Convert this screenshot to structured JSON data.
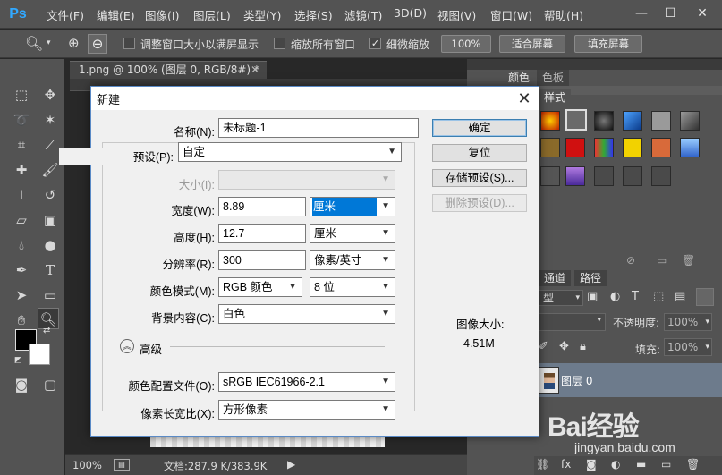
{
  "app": {
    "logo": "Ps"
  },
  "menubar": {
    "items": [
      "文件(F)",
      "编辑(E)",
      "图像(I)",
      "图层(L)",
      "类型(Y)",
      "选择(S)",
      "滤镜(T)",
      "3D(D)",
      "视图(V)",
      "窗口(W)",
      "帮助(H)"
    ],
    "window_controls": {
      "minimize": "—",
      "maximize": "☐",
      "close": "✕"
    }
  },
  "options": {
    "resize_windows": "调整窗口大小以满屏显示",
    "zoom_all": "缩放所有窗口",
    "scrubby": "细微缩放",
    "zoom_pct": "100%",
    "fit_screen": "适合屏幕",
    "fill_screen": "填充屏幕"
  },
  "document": {
    "tab": "1.png @ 100% (图层 0, RGB/8#) *",
    "zoom": "100%",
    "doc_info": "文档:287.9 K/383.9K"
  },
  "panels": {
    "color_tab": "颜色",
    "swatches_tab": "色板",
    "styles_tab": "样式",
    "channels_tab": "通道",
    "paths_tab": "路径",
    "kind": "型",
    "opacity_label": "不透明度:",
    "opacity": "100%",
    "fill_label": "填充:",
    "fill": "100%",
    "layer_name": "图层 0"
  },
  "dialog": {
    "title": "新建",
    "name_label": "名称(N):",
    "name_value": "未标题-1",
    "preset_label": "预设(P):",
    "preset_value": "自定",
    "size_label": "大小(I):",
    "width_label": "宽度(W):",
    "width_value": "8.89",
    "width_unit": "厘米",
    "height_label": "高度(H):",
    "height_value": "12.7",
    "height_unit": "厘米",
    "resolution_label": "分辨率(R):",
    "resolution_value": "300",
    "resolution_unit": "像素/英寸",
    "color_mode_label": "颜色模式(M):",
    "color_mode_value": "RGB 颜色",
    "bit_depth": "8 位",
    "background_label": "背景内容(C):",
    "background_value": "白色",
    "advanced_label": "高级",
    "color_profile_label": "颜色配置文件(O):",
    "color_profile_value": "sRGB IEC61966-2.1",
    "pixel_aspect_label": "像素长宽比(X):",
    "pixel_aspect_value": "方形像素",
    "ok": "确定",
    "reset": "复位",
    "save_preset": "存储预设(S)...",
    "delete_preset": "删除预设(D)...",
    "image_size_label": "图像大小:",
    "image_size_value": "4.51M"
  },
  "watermark": {
    "brand": "Bai经验",
    "url": "jingyan.baidu.com"
  },
  "colors": {
    "accent": "#31a8ff",
    "selection": "#0078d7"
  }
}
